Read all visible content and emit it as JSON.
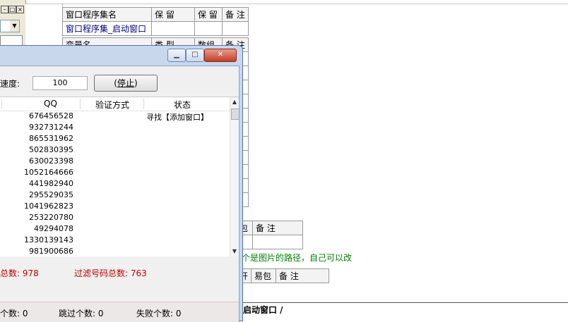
{
  "ide": {
    "mdi_buttons": [
      "–",
      "□",
      "×"
    ],
    "combo_arrow": "▼",
    "program_set_table": {
      "headers": [
        "窗口程序集名",
        "保 留",
        "保 留",
        "备 注"
      ],
      "row": [
        "窗口程序集_启动窗口",
        "",
        "",
        ""
      ]
    },
    "var_table": {
      "headers": [
        "变量名",
        "类 型",
        "数组",
        "备 注"
      ]
    },
    "lib_table_headers": [
      "包",
      "备 注"
    ],
    "path_note": "个是图片的路径，自己可以改",
    "dll_table_headers": [
      "开",
      "易包",
      "备 注"
    ],
    "bottom_tab": "启动窗口 /"
  },
  "dialog": {
    "title_buttons": [
      "▁",
      "□",
      "✕"
    ],
    "speed_label": "速度:",
    "speed_value": "100",
    "stop_button": "停止",
    "columns": [
      "QQ",
      "验证方式",
      "状态"
    ],
    "rows": [
      {
        "qq": "676456528",
        "status": "寻找【添加窗口】"
      },
      {
        "qq": "932731244",
        "status": ""
      },
      {
        "qq": "865531962",
        "status": ""
      },
      {
        "qq": "502830395",
        "status": ""
      },
      {
        "qq": "630023398",
        "status": ""
      },
      {
        "qq": "1052164666",
        "status": ""
      },
      {
        "qq": "441982940",
        "status": ""
      },
      {
        "qq": "295529035",
        "status": ""
      },
      {
        "qq": "1041962823",
        "status": ""
      },
      {
        "qq": "253220780",
        "status": ""
      },
      {
        "qq": "49294078",
        "status": ""
      },
      {
        "qq": "1330139143",
        "status": ""
      },
      {
        "qq": "981900686",
        "status": ""
      }
    ],
    "total_label": "总数:",
    "total_value": "978",
    "filtered_label": "过滤号码总数:",
    "filtered_value": "763",
    "footer": {
      "count_label": "个数:",
      "count_value": "0",
      "skip_label": "跳过个数:",
      "skip_value": "0",
      "fail_label": "失败个数:",
      "fail_value": "0"
    }
  }
}
